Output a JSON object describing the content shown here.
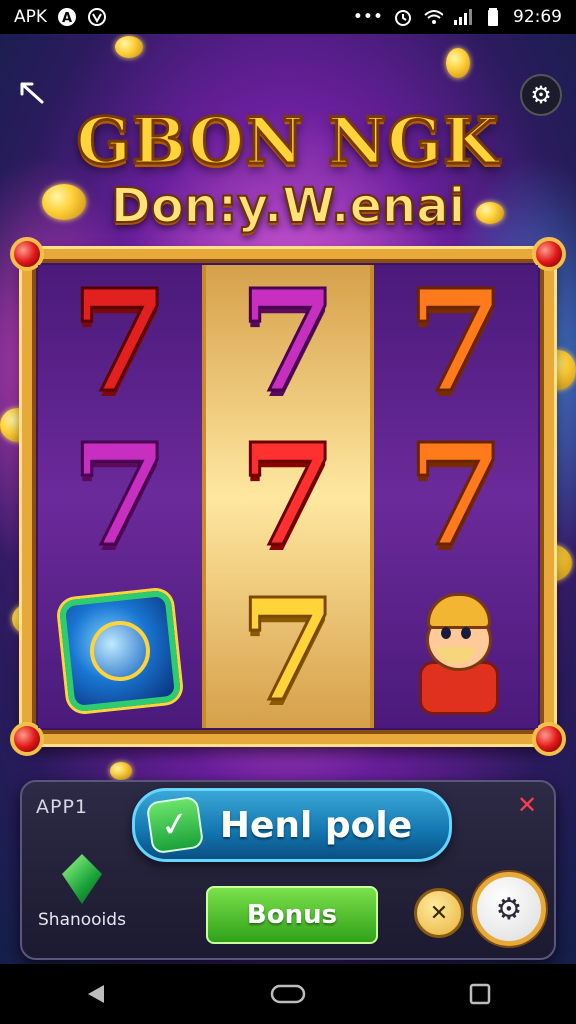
{
  "status_bar": {
    "app_label": "APK",
    "time": "92:69",
    "left_icons": [
      "app-a-icon",
      "app-v-icon"
    ],
    "right_icons": [
      "more-dots-icon",
      "alarm-icon",
      "wifi-icon",
      "signal-icon",
      "battery-icon"
    ]
  },
  "header": {
    "title_line1": "GBON NGK",
    "title_line2": "Don:y.W.enai",
    "back_icon": "back-arrow-icon",
    "settings_icon": "gear-icon"
  },
  "reels": [
    {
      "symbols": [
        "7",
        "7",
        "gem"
      ]
    },
    {
      "symbols": [
        "7",
        "7",
        "7"
      ]
    },
    {
      "symbols": [
        "7",
        "7",
        "character"
      ]
    }
  ],
  "panel": {
    "label": "APP1",
    "main_button_label": "Henl pole",
    "main_button_icon": "checkmark-icon",
    "diamond_label": "Shanooids",
    "bonus_label": "Bonus",
    "close_icon": "close-x-icon",
    "x_icon": "cross-icon",
    "gear_icon": "gear-icon"
  },
  "navbar": {
    "icons": [
      "back-triangle-icon",
      "home-icon",
      "recents-icon"
    ]
  },
  "colors": {
    "frame_gold": "#e7a93a",
    "title_gold": "#ffd43b",
    "primary_button": "#1276b0",
    "bonus_green": "#2fa21a",
    "close_red": "#ff3b4f"
  }
}
